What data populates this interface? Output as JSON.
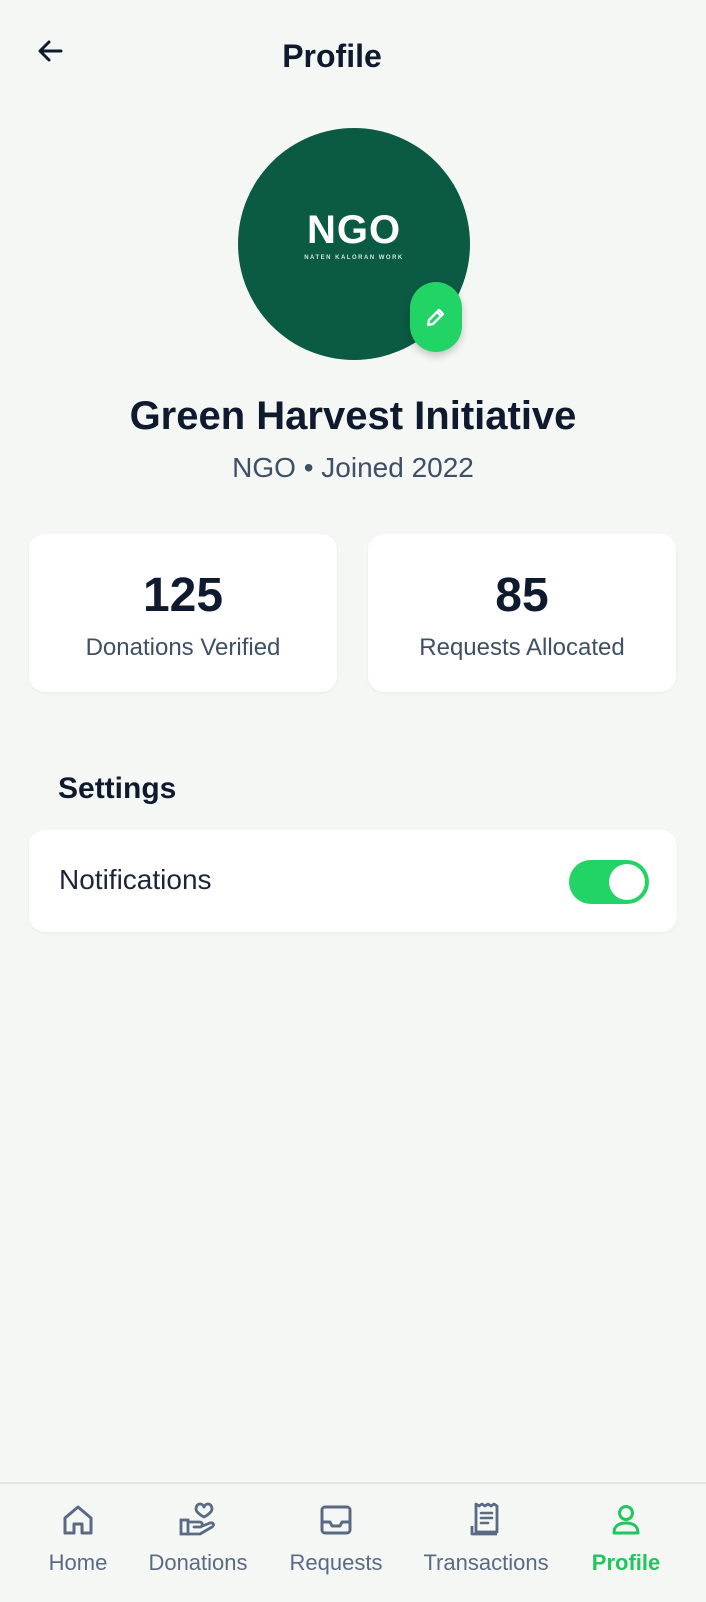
{
  "header": {
    "title": "Profile"
  },
  "avatar": {
    "logo_text": "NGO",
    "logo_subtext": "NATEN KALORAN WORK"
  },
  "profile": {
    "name": "Green Harvest Initiative",
    "meta": "NGO • Joined 2022"
  },
  "stats": [
    {
      "value": "125",
      "label": "Donations Verified"
    },
    {
      "value": "85",
      "label": "Requests Allocated"
    }
  ],
  "settings": {
    "title": "Settings",
    "items": [
      {
        "label": "Notifications",
        "enabled": true
      }
    ]
  },
  "nav": {
    "items": [
      {
        "label": "Home",
        "icon": "home-icon"
      },
      {
        "label": "Donations",
        "icon": "donations-icon"
      },
      {
        "label": "Requests",
        "icon": "inbox-icon"
      },
      {
        "label": "Transactions",
        "icon": "receipt-icon"
      },
      {
        "label": "Profile",
        "icon": "user-icon",
        "active": true
      }
    ]
  },
  "colors": {
    "accent": "#22d366",
    "avatar_bg": "#0b5a43",
    "text_primary": "#0f1a2e",
    "text_secondary": "#3f4f66",
    "background": "#f5f7f5"
  }
}
